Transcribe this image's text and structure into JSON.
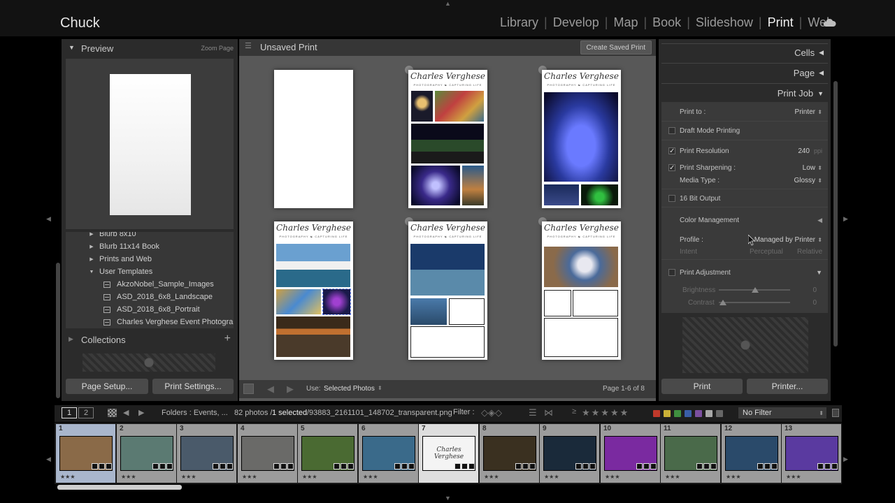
{
  "app": {
    "identity": "Chuck"
  },
  "modules": [
    "Library",
    "Develop",
    "Map",
    "Book",
    "Slideshow",
    "Print",
    "Web"
  ],
  "active_module": "Print",
  "left_panel": {
    "preview_title": "Preview",
    "preview_action": "Zoom Page",
    "templates": [
      {
        "label": "Blurb 8x10",
        "kind": "folder",
        "expanded": false
      },
      {
        "label": "Blurb 11x14 Book",
        "kind": "folder",
        "expanded": false
      },
      {
        "label": "Prints and Web",
        "kind": "folder",
        "expanded": false
      },
      {
        "label": "User Templates",
        "kind": "folder",
        "expanded": true
      },
      {
        "label": "AkzoNobel_Sample_Images",
        "kind": "template"
      },
      {
        "label": "ASD_2018_6x8_Landscape",
        "kind": "template"
      },
      {
        "label": "ASD_2018_6x8_Portrait",
        "kind": "template"
      },
      {
        "label": "Charles Verghese Event Photograp...",
        "kind": "template"
      }
    ],
    "collections_title": "Collections",
    "collections_add": "+",
    "page_setup_label": "Page Setup...",
    "print_settings_label": "Print Settings..."
  },
  "center": {
    "title": "Unsaved Print",
    "create_saved_print": "Create Saved Print",
    "signature_title": "Charles Verghese",
    "signature_subtitle": "PHOTOGRAPHY  ☯  CAPTURING LIFE",
    "use_label": "Use:",
    "use_value": "Selected Photos",
    "page_status": "Page 1-6 of 8"
  },
  "right_panel": {
    "sections": {
      "cells": "Cells",
      "page": "Page",
      "print_job": "Print Job"
    },
    "print_to_label": "Print to :",
    "print_to_value": "Printer",
    "draft_mode": {
      "label": "Draft Mode Printing",
      "checked": false
    },
    "print_resolution": {
      "label": "Print Resolution",
      "checked": true,
      "value": "240",
      "unit": "ppi"
    },
    "print_sharpening": {
      "label": "Print Sharpening :",
      "checked": true,
      "value": "Low"
    },
    "media_type": {
      "label": "Media Type :",
      "value": "Glossy"
    },
    "bit_output": {
      "label": "16 Bit Output",
      "checked": false
    },
    "color_management": {
      "title": "Color Management",
      "profile_label": "Profile :",
      "profile_value": "Managed by Printer",
      "intent_label": "Intent",
      "intent_perceptual": "Perceptual",
      "intent_relative": "Relative"
    },
    "print_adjustment": {
      "label": "Print Adjustment",
      "checked": false,
      "brightness_label": "Brightness",
      "brightness_value": "0",
      "contrast_label": "Contrast",
      "contrast_value": "0"
    },
    "print_button": "Print",
    "printer_button": "Printer..."
  },
  "filmstrip_bar": {
    "monitor_1": "1",
    "monitor_2": "2",
    "source": "Folders : Events, ...",
    "photo_count": "82 photos /",
    "selected_count": "1 selected",
    "filename": "/93883_2161101_148702_transparent.png",
    "filter_label": "Filter :",
    "rating_operator": "≥",
    "stars": "★★★★★",
    "filter_value": "No Filter",
    "label_colors": [
      "#c0392b",
      "#c9b037",
      "#3f8f3f",
      "#3a5ea8",
      "#7b4fa0",
      "#a8a8a8",
      "#666666"
    ]
  },
  "filmstrip": {
    "items": [
      {
        "num": "1",
        "stars": "★★★",
        "color": "#8a6a48"
      },
      {
        "num": "2",
        "stars": "★★★",
        "color": "#5b7a72"
      },
      {
        "num": "3",
        "stars": "★★★",
        "color": "#4a5a6a"
      },
      {
        "num": "4",
        "stars": "★★★",
        "color": "#6a6a68"
      },
      {
        "num": "5",
        "stars": "★★★",
        "color": "#4a6a32"
      },
      {
        "num": "6",
        "stars": "★★★",
        "color": "#3a6a8a"
      },
      {
        "num": "7",
        "stars": "",
        "color": "#f4f4f4",
        "selected": true,
        "label": "Charles Verghese"
      },
      {
        "num": "8",
        "stars": "★★★",
        "color": "#3a3020"
      },
      {
        "num": "9",
        "stars": "★★★",
        "color": "#1a2a3a"
      },
      {
        "num": "10",
        "stars": "★★★",
        "color": "#7a2aa0"
      },
      {
        "num": "11",
        "stars": "★★★",
        "color": "#4a6a4a"
      },
      {
        "num": "12",
        "stars": "★★★",
        "color": "#2a4a6a"
      },
      {
        "num": "13",
        "stars": "★★★",
        "color": "#5a3aa0"
      }
    ]
  }
}
